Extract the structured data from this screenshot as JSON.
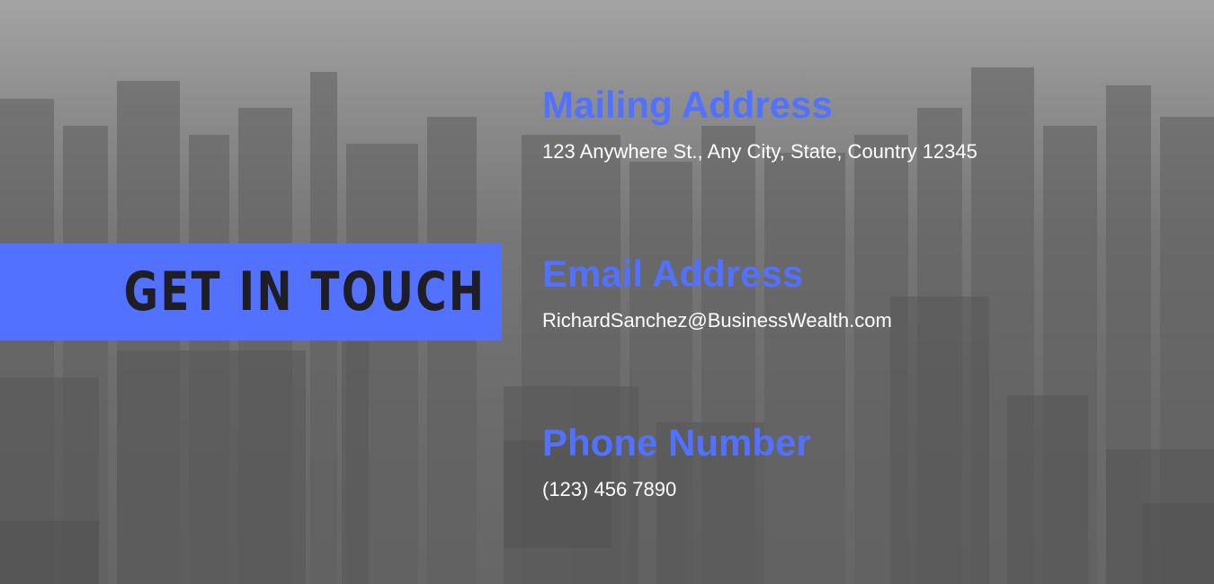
{
  "banner": {
    "title": "GET IN TOUCH"
  },
  "contacts": [
    {
      "heading": "Mailing Address",
      "value": "123 Anywhere St., Any City, State, Country 12345"
    },
    {
      "heading": "Email Address",
      "value": "RichardSanchez@BusinessWealth.com"
    },
    {
      "heading": "Phone Number",
      "value": "(123) 456 7890"
    }
  ],
  "colors": {
    "accent": "#5271ff",
    "banner_text": "#1e1e24",
    "value_text": "#ffffff",
    "background": "#6e6e6e"
  }
}
